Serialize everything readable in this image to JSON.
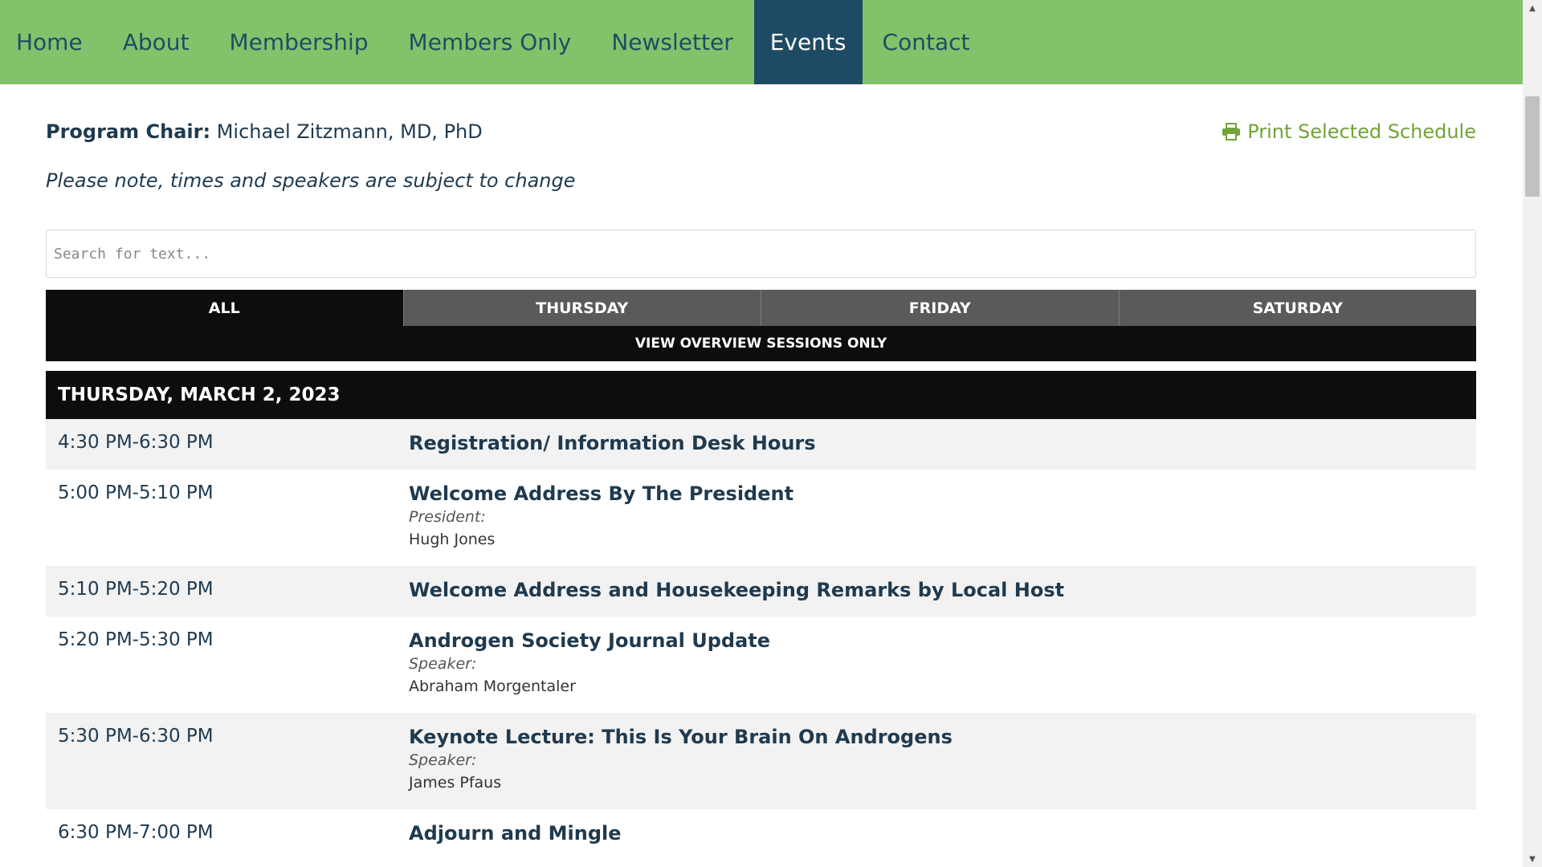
{
  "nav": {
    "items": [
      {
        "label": "Home"
      },
      {
        "label": "About"
      },
      {
        "label": "Membership"
      },
      {
        "label": "Members Only"
      },
      {
        "label": "Newsletter"
      },
      {
        "label": "Events",
        "active": true
      },
      {
        "label": "Contact"
      }
    ]
  },
  "program": {
    "chair_label": "Program Chair:",
    "chair_name": "Michael Zitzmann, MD, PhD",
    "print_label": "Print Selected Schedule",
    "note": "Please note, times and speakers are subject to change"
  },
  "search": {
    "placeholder": "Search for text..."
  },
  "tabs": [
    {
      "label": "ALL",
      "active": true
    },
    {
      "label": "THURSDAY"
    },
    {
      "label": "FRIDAY"
    },
    {
      "label": "SATURDAY"
    }
  ],
  "overview_label": "VIEW OVERVIEW SESSIONS ONLY",
  "day_header": "THURSDAY, MARCH 2, 2023",
  "sessions": [
    {
      "time": "4:30 PM-6:30 PM",
      "title": "Registration/ Information Desk Hours",
      "role": "",
      "person": ""
    },
    {
      "time": "5:00 PM-5:10 PM",
      "title": "Welcome Address By The President",
      "role": "President:",
      "person": "Hugh Jones"
    },
    {
      "time": "5:10 PM-5:20 PM",
      "title": "Welcome Address and Housekeeping Remarks by Local Host",
      "role": "",
      "person": ""
    },
    {
      "time": "5:20 PM-5:30 PM",
      "title": "Androgen Society Journal Update",
      "role": "Speaker:",
      "person": "Abraham Morgentaler"
    },
    {
      "time": "5:30 PM-6:30 PM",
      "title": "Keynote Lecture: This Is Your Brain On Androgens",
      "role": "Speaker:",
      "person": "James Pfaus"
    },
    {
      "time": "6:30 PM-7:00 PM",
      "title": "Adjourn and Mingle",
      "role": "",
      "person": ""
    }
  ],
  "colors": {
    "nav_bg": "#82c26b",
    "nav_active": "#1f4a63",
    "print_link": "#72a23a",
    "tab_bg": "#5a5a5a",
    "tab_active": "#0d0d0d"
  }
}
